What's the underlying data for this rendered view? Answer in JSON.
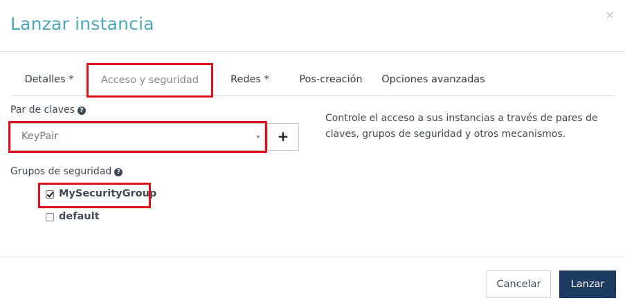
{
  "header": {
    "title": "Lanzar instancia",
    "close_label": "×"
  },
  "tabs": [
    {
      "label": "Detalles *"
    },
    {
      "label": "Acceso y seguridad",
      "active": true
    },
    {
      "label": "Redes *"
    },
    {
      "label": "Pos-creación"
    },
    {
      "label": "Opciones avanzadas"
    }
  ],
  "keypair": {
    "label": "Par de claves",
    "help_icon": "question-circle-icon",
    "selected": "KeyPair",
    "add_label": "+"
  },
  "security_groups": {
    "label": "Grupos de seguridad",
    "help_icon": "question-circle-icon",
    "items": [
      {
        "label": "MySecurityGroup",
        "checked": true
      },
      {
        "label": "default",
        "checked": false
      }
    ]
  },
  "help_text": "Controle el acceso a sus instancias a través de pares de claves, grupos de seguridad y otros mecanismos.",
  "footer": {
    "cancel_label": "Cancelar",
    "launch_label": "Lanzar"
  },
  "colors": {
    "title": "#4aa8bf",
    "highlight": "#e0101a",
    "primary_button": "#1e3b62"
  }
}
